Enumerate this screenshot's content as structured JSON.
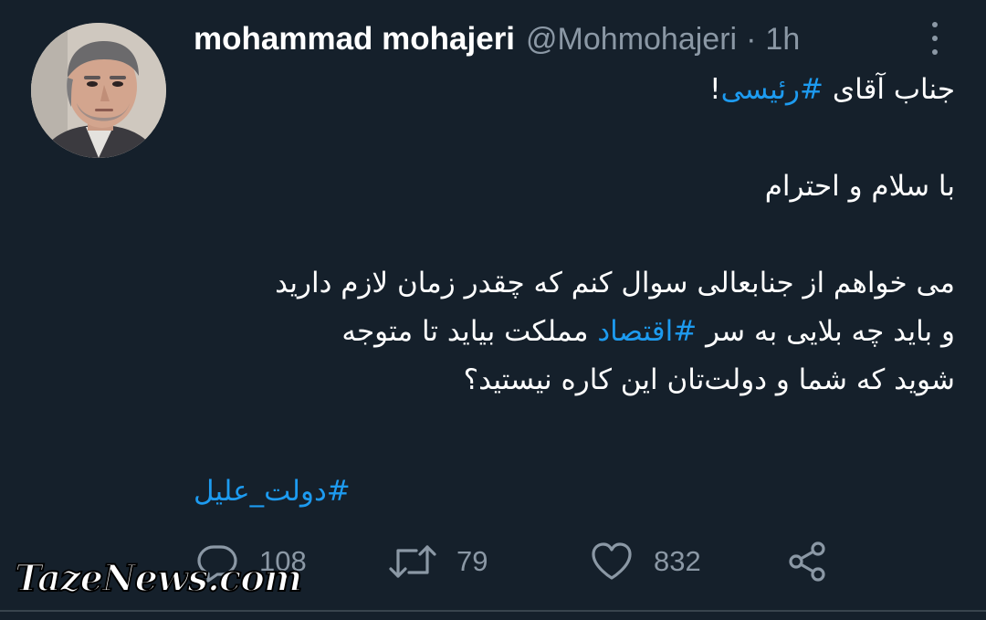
{
  "tweet": {
    "display_name": "mohammad mohajeri",
    "handle": "@Mohmohajeri",
    "separator": "·",
    "time": "1h",
    "lines": {
      "l1_prefix": "جناب آقای ",
      "l1_hashtag": "#رئیسی",
      "l1_suffix": "!",
      "l2": "با سلام و احترام",
      "l3": "می خواهم از جنابعالی سوال کنم که چقدر زمان لازم دارید",
      "l4_prefix": "و باید چه بلایی به سر ",
      "l4_hashtag": "#اقتصاد",
      "l4_suffix": " مملکت بیاید تا متوجه",
      "l5": "شوید که شما و دولت‌تان این کاره نیستید؟"
    },
    "hashtag_footer": "#دولت_علیل"
  },
  "actions": {
    "reply_count": "108",
    "retweet_count": "79",
    "like_count": "832",
    "icons": [
      "reply-icon",
      "retweet-icon",
      "like-icon",
      "share-icon"
    ]
  },
  "watermark": {
    "text": "TazeNews.com"
  },
  "colors": {
    "background": "#15202b",
    "text": "#ffffff",
    "muted": "#8b98a5",
    "accent": "#1d9bf0"
  }
}
